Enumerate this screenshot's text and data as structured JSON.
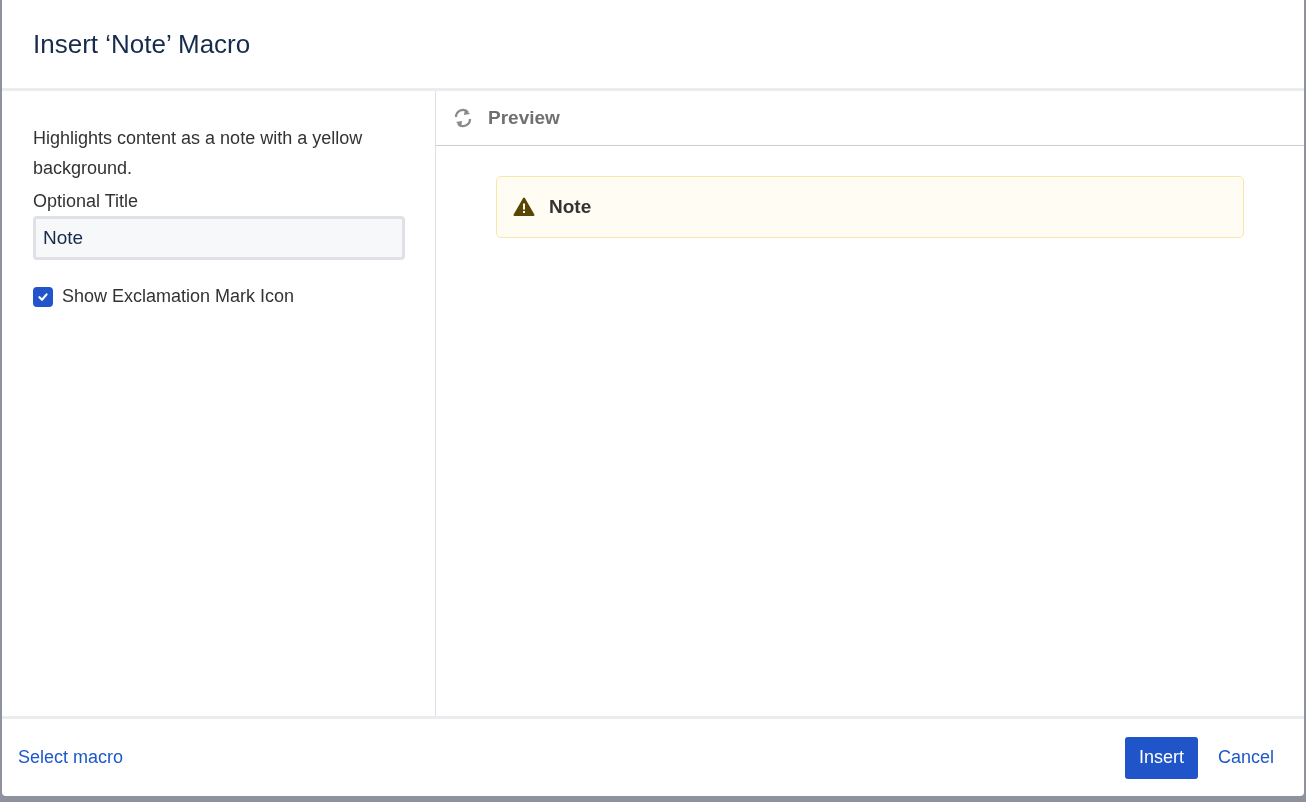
{
  "dialog": {
    "title": "Insert ‘Note’ Macro"
  },
  "settings": {
    "description": "Highlights content as a note with a yellow background.",
    "title_field": {
      "label": "Optional Title",
      "value": "Note"
    },
    "checkbox": {
      "label": "Show Exclamation Mark Icon",
      "checked": true
    }
  },
  "preview": {
    "heading": "Preview",
    "note_title": "Note"
  },
  "footer": {
    "link": "Select macro",
    "buttons": [
      {
        "label": "Insert",
        "kind": "primary"
      },
      {
        "label": "Cancel",
        "kind": "link"
      }
    ]
  }
}
